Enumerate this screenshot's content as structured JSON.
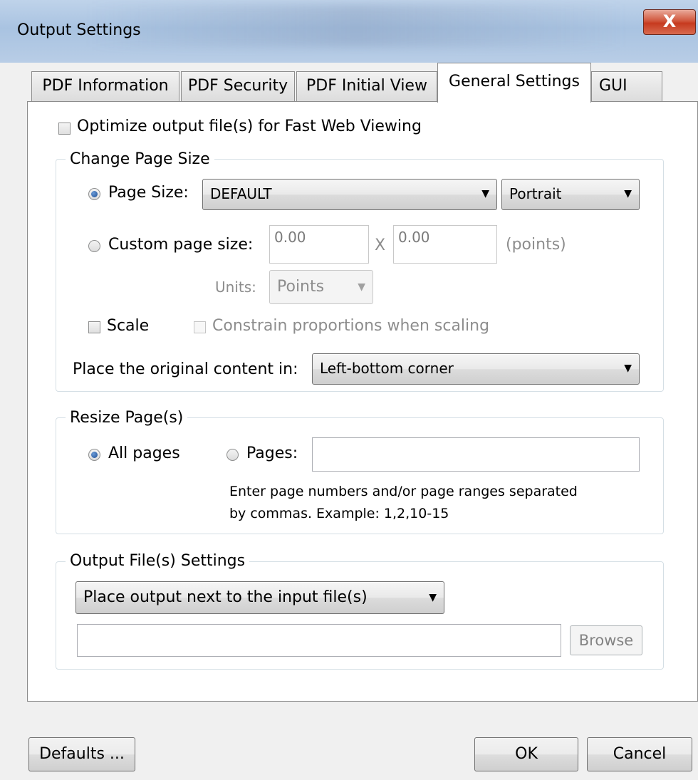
{
  "window": {
    "title": "Output Settings",
    "close_glyph": "X"
  },
  "tabs": [
    {
      "label": "PDF Information",
      "active": false
    },
    {
      "label": "PDF Security",
      "active": false
    },
    {
      "label": "PDF Initial View",
      "active": false
    },
    {
      "label": "General Settings",
      "active": true
    },
    {
      "label": "GUI",
      "active": false
    }
  ],
  "fast_web": {
    "label": "Optimize output file(s) for Fast Web Viewing",
    "checked": false
  },
  "change_page_size": {
    "title": "Change Page Size",
    "page_size_label": "Page Size:",
    "page_size_value": "DEFAULT",
    "orientation_value": "Portrait",
    "custom_label": "Custom page size:",
    "width_value": "0.00",
    "x_label": "X",
    "height_value": "0.00",
    "points_label": "(points)",
    "units_label": "Units:",
    "units_value": "Points",
    "scale_label": "Scale",
    "constrain_label": "Constrain proportions when scaling",
    "place_label": "Place the original content in:",
    "place_value": "Left-bottom corner"
  },
  "resize_pages": {
    "title": "Resize Page(s)",
    "all_label": "All pages",
    "pages_label": "Pages:",
    "pages_value": "",
    "hint_line1": "Enter page numbers and/or page ranges separated",
    "hint_line2": "by commas. Example: 1,2,10-15"
  },
  "output_files": {
    "title": "Output File(s) Settings",
    "location_value": "Place output next to the input file(s)",
    "path_value": "",
    "browse_label": "Browse"
  },
  "footer": {
    "defaults_label": "Defaults ...",
    "ok_label": "OK",
    "cancel_label": "Cancel"
  },
  "glyphs": {
    "dropdown_arrow": "▼"
  }
}
